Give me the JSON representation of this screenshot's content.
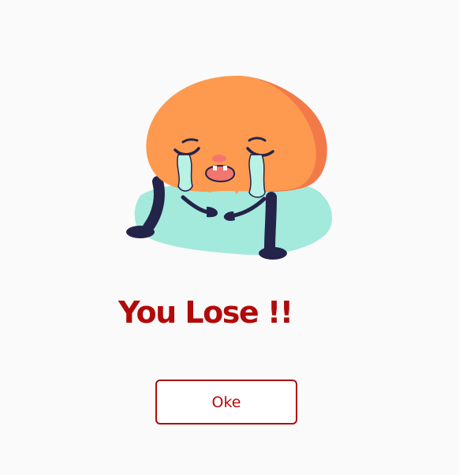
{
  "illustration": {
    "name": "crying-character",
    "colors": {
      "body": "#fd9a4f",
      "body_shade": "#f27a48",
      "puddle": "#a3e9dc",
      "limbs": "#24234a",
      "tears": "#b9f1e5",
      "mouth": "#f2766d"
    }
  },
  "result": {
    "title": "You Lose !!",
    "color": "#b20a0a"
  },
  "actions": {
    "ok_label": "Oke"
  }
}
